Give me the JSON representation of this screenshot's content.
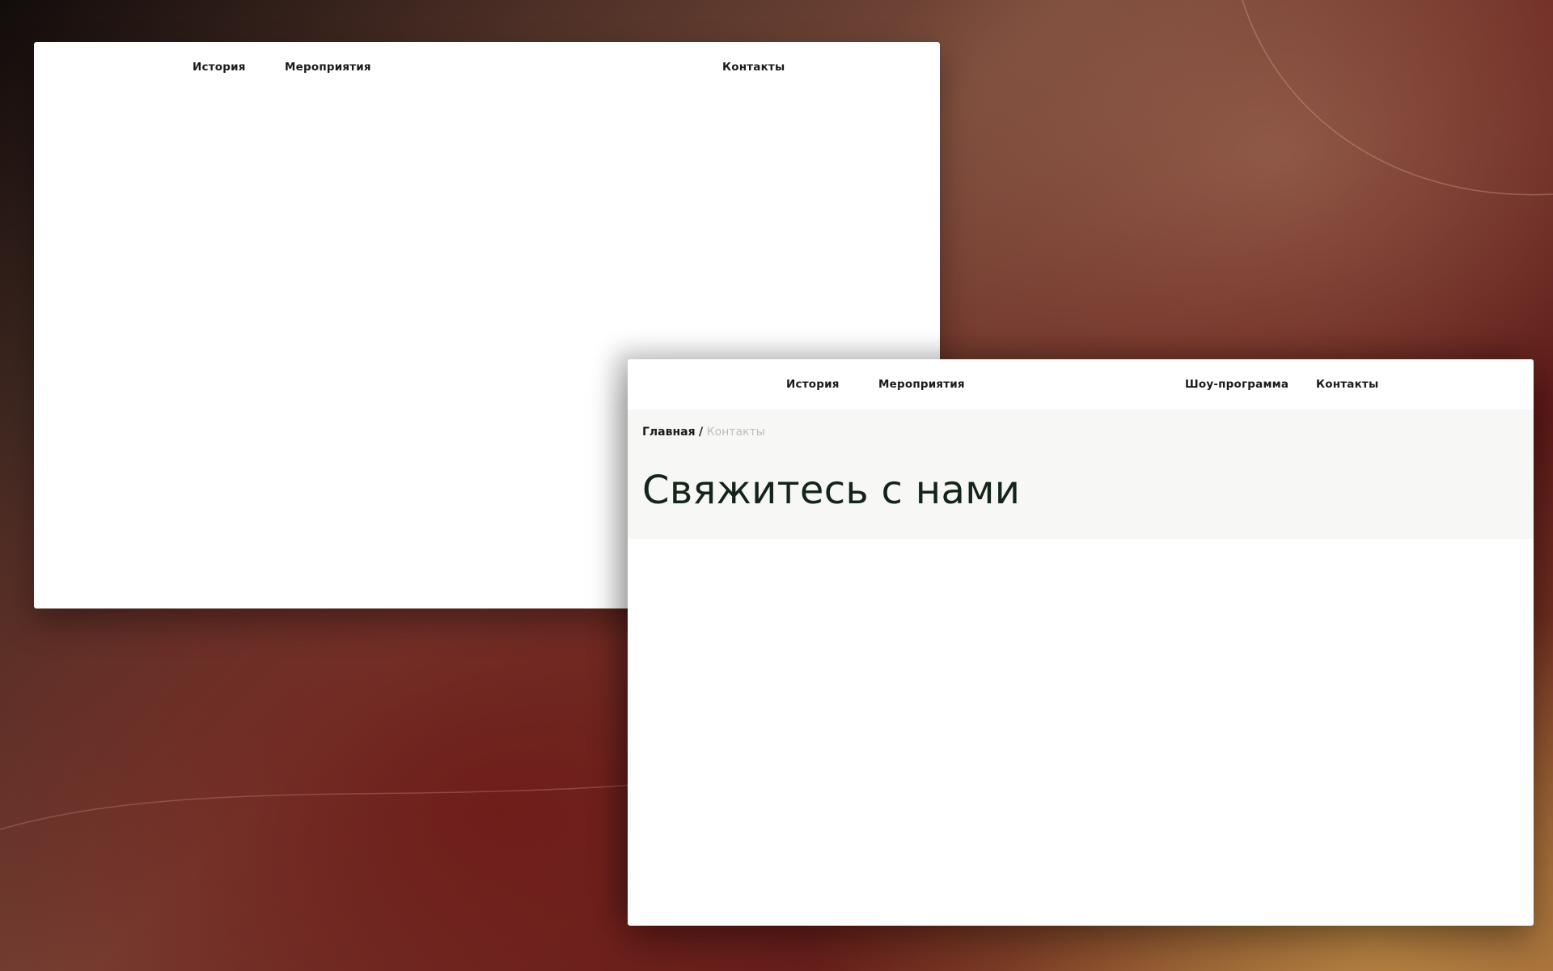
{
  "background": {
    "colors": {
      "dark": "#120c0b",
      "brown": "#7a4a3a",
      "maroon": "#5c1a18",
      "amber": "#c49248"
    }
  },
  "back_window": {
    "nav": {
      "history": "История",
      "events": "Мероприятия",
      "contacts": "Контакты"
    }
  },
  "front_window": {
    "nav": {
      "history": "История",
      "events": "Мероприятия",
      "show": "Шоу-программа",
      "contacts": "Контакты"
    },
    "breadcrumb": {
      "home": "Главная",
      "separator": "/",
      "current": "Контакты"
    },
    "title": "Свяжитесь с нами",
    "colors": {
      "title": "#132418",
      "breadcrumb_current": "#bdbdbd",
      "hero_bg": "#f7f7f6"
    }
  }
}
